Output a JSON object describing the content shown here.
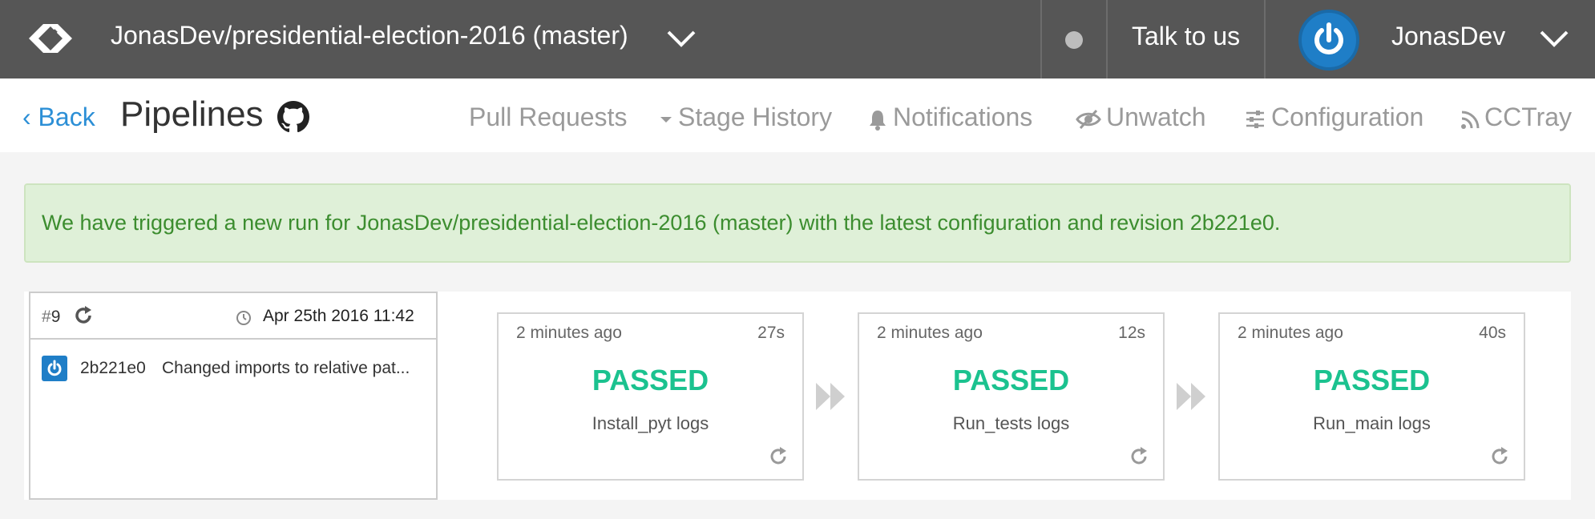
{
  "topbar": {
    "repo_title": "JonasDev/presidential-election-2016 (master)",
    "talk_label": "Talk to us",
    "user_name": "JonasDev",
    "status_color": "#bdbdbd"
  },
  "subheader": {
    "back_label": "Back",
    "title": "Pipelines",
    "nav": [
      {
        "label": "Pull Requests",
        "icon": ""
      },
      {
        "label": "Stage History",
        "icon": "caret-down-icon"
      },
      {
        "label": "Notifications",
        "icon": "bell-icon"
      },
      {
        "label": "Unwatch",
        "icon": "eye-slash-icon"
      },
      {
        "label": "Configuration",
        "icon": "sliders-icon"
      },
      {
        "label": "CCTray",
        "icon": "rss-icon"
      }
    ]
  },
  "alert": {
    "text": "We have triggered a new run for JonasDev/presidential-election-2016 (master) with the latest configuration and revision 2b221e0."
  },
  "run": {
    "hash": "#",
    "number": "9",
    "date": "Apr 25th 2016 11:42",
    "commit_sha": "2b221e0",
    "commit_message": "Changed imports to relative pat..."
  },
  "stages": [
    {
      "ago": "2 minutes ago",
      "duration": "27s",
      "status": "PASSED",
      "logs": "Install_pyt logs"
    },
    {
      "ago": "2 minutes ago",
      "duration": "12s",
      "status": "PASSED",
      "logs": "Run_tests logs"
    },
    {
      "ago": "2 minutes ago",
      "duration": "40s",
      "status": "PASSED",
      "logs": "Run_main logs"
    }
  ],
  "colors": {
    "topbar": "#565656",
    "link": "#2c8fd6",
    "passed": "#1bc28f",
    "alert_bg": "#dff0d8",
    "alert_text": "#3c8d2f"
  }
}
